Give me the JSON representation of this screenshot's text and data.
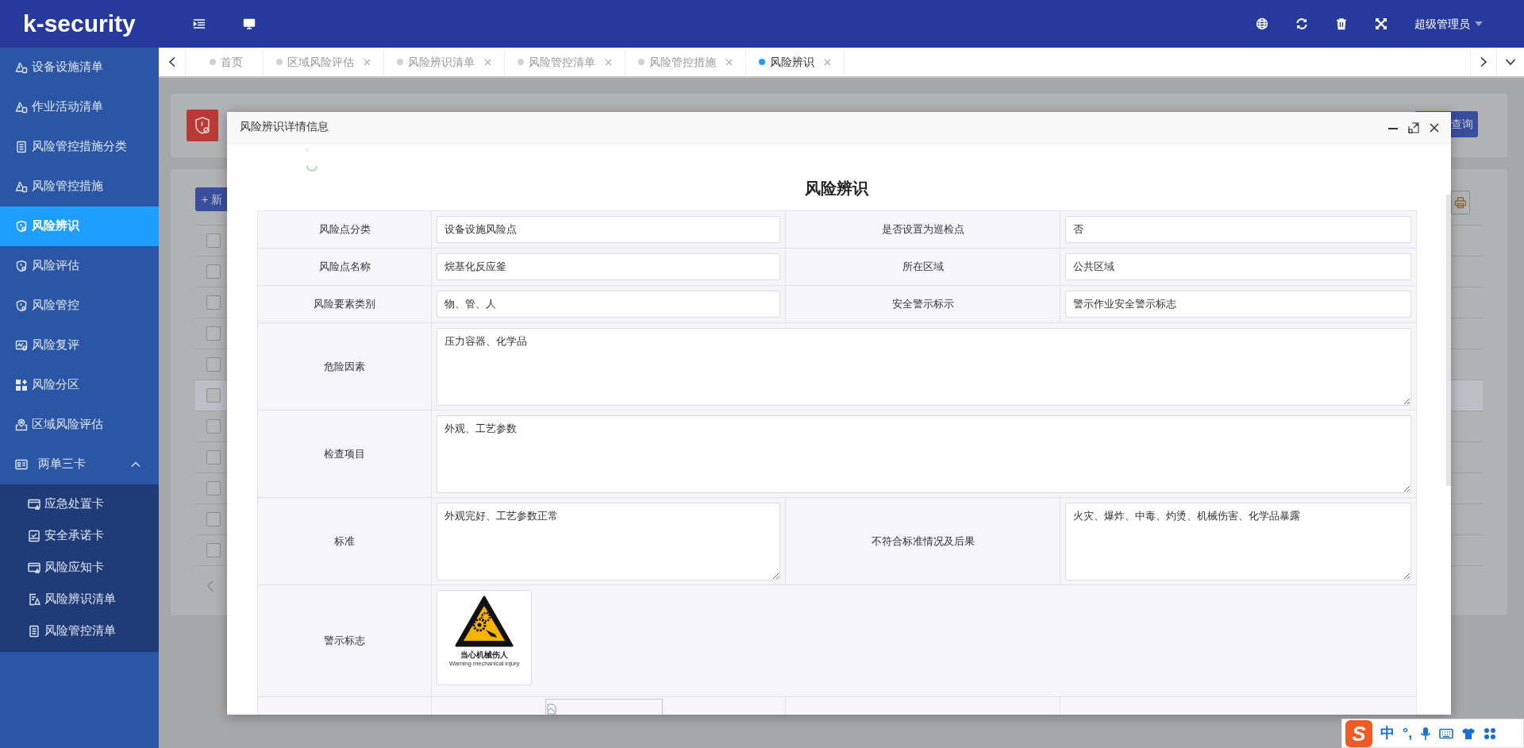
{
  "header": {
    "logo": "k-security",
    "user": "超级管理员"
  },
  "sidebar": {
    "items": [
      {
        "label": "设备设施清单",
        "selected": false
      },
      {
        "label": "作业活动清单",
        "selected": false
      },
      {
        "label": "风险管控措施分类",
        "selected": false
      },
      {
        "label": "风险管控措施",
        "selected": false
      },
      {
        "label": "风险辨识",
        "selected": true
      },
      {
        "label": "风险评估",
        "selected": false
      },
      {
        "label": "风险管控",
        "selected": false
      },
      {
        "label": "风险复评",
        "selected": false
      },
      {
        "label": "风险分区",
        "selected": false
      },
      {
        "label": "区域风险评估",
        "selected": false
      },
      {
        "label": "两单三卡",
        "selected": false,
        "expanded": true,
        "children": [
          {
            "label": "应急处置卡",
            "selected": false
          },
          {
            "label": "安全承诺卡",
            "selected": false
          },
          {
            "label": "风险应知卡",
            "selected": false
          },
          {
            "label": "风险辨识清单",
            "selected": false
          },
          {
            "label": "风险管控清单",
            "selected": false
          }
        ]
      }
    ]
  },
  "tabs": [
    {
      "label": "首页",
      "selected": false,
      "closable": false
    },
    {
      "label": "区域风险评估",
      "selected": false,
      "closable": true
    },
    {
      "label": "风险辨识清单",
      "selected": false,
      "closable": true
    },
    {
      "label": "风险管控清单",
      "selected": false,
      "closable": true
    },
    {
      "label": "风险管控措施",
      "selected": false,
      "closable": true
    },
    {
      "label": "风险辨识",
      "selected": true,
      "closable": true
    }
  ],
  "background_page": {
    "add_button": "+ 新",
    "query_button": "查询",
    "rows": [
      {
        "checked": false,
        "selected": false
      },
      {
        "checked": false,
        "selected": false
      },
      {
        "checked": false,
        "selected": false
      },
      {
        "checked": false,
        "selected": false
      },
      {
        "checked": false,
        "selected": false
      },
      {
        "checked": false,
        "selected": true
      },
      {
        "checked": false,
        "selected": false
      },
      {
        "checked": false,
        "selected": false
      },
      {
        "checked": false,
        "selected": false
      },
      {
        "checked": false,
        "selected": false
      },
      {
        "checked": false,
        "selected": false
      }
    ]
  },
  "dialog": {
    "title": "风险辨识详情信息",
    "heading": "风险辨识",
    "rows": [
      {
        "kind": "fields",
        "cells": [
          {
            "label": "风险点分类",
            "value": "设备设施风险点"
          },
          {
            "label": "是否设置为巡检点",
            "value": "否"
          }
        ]
      },
      {
        "kind": "fields",
        "cells": [
          {
            "label": "风险点名称",
            "value": "烷基化反应釜"
          },
          {
            "label": "所在区域",
            "value": "公共区域"
          }
        ]
      },
      {
        "kind": "fields",
        "cells": [
          {
            "label": "风险要素类别",
            "value": "物、管、人"
          },
          {
            "label": "安全警示标示",
            "value": "警示作业安全警示标志"
          }
        ]
      },
      {
        "kind": "area",
        "cells": [
          {
            "label": "危险因素",
            "value": "压力容器、化学品"
          }
        ]
      },
      {
        "kind": "area",
        "cells": [
          {
            "label": "检查项目",
            "value": "外观、工艺参数"
          }
        ]
      },
      {
        "kind": "area",
        "cells": [
          {
            "label": "标准",
            "value": "外观完好、工艺参数正常"
          },
          {
            "label": "不符合标准情况及后果",
            "value": "火灾、爆炸、中毒、灼烫、机械伤害、化学品暴露"
          }
        ]
      },
      {
        "kind": "sign",
        "label": "警示标志",
        "caption": "当心机械伤人",
        "caption_en": "Warning mechanical injury"
      },
      {
        "kind": "image"
      }
    ]
  },
  "ime_bar": {
    "logo": "S",
    "mode": "中",
    "punctuation": "°,"
  }
}
